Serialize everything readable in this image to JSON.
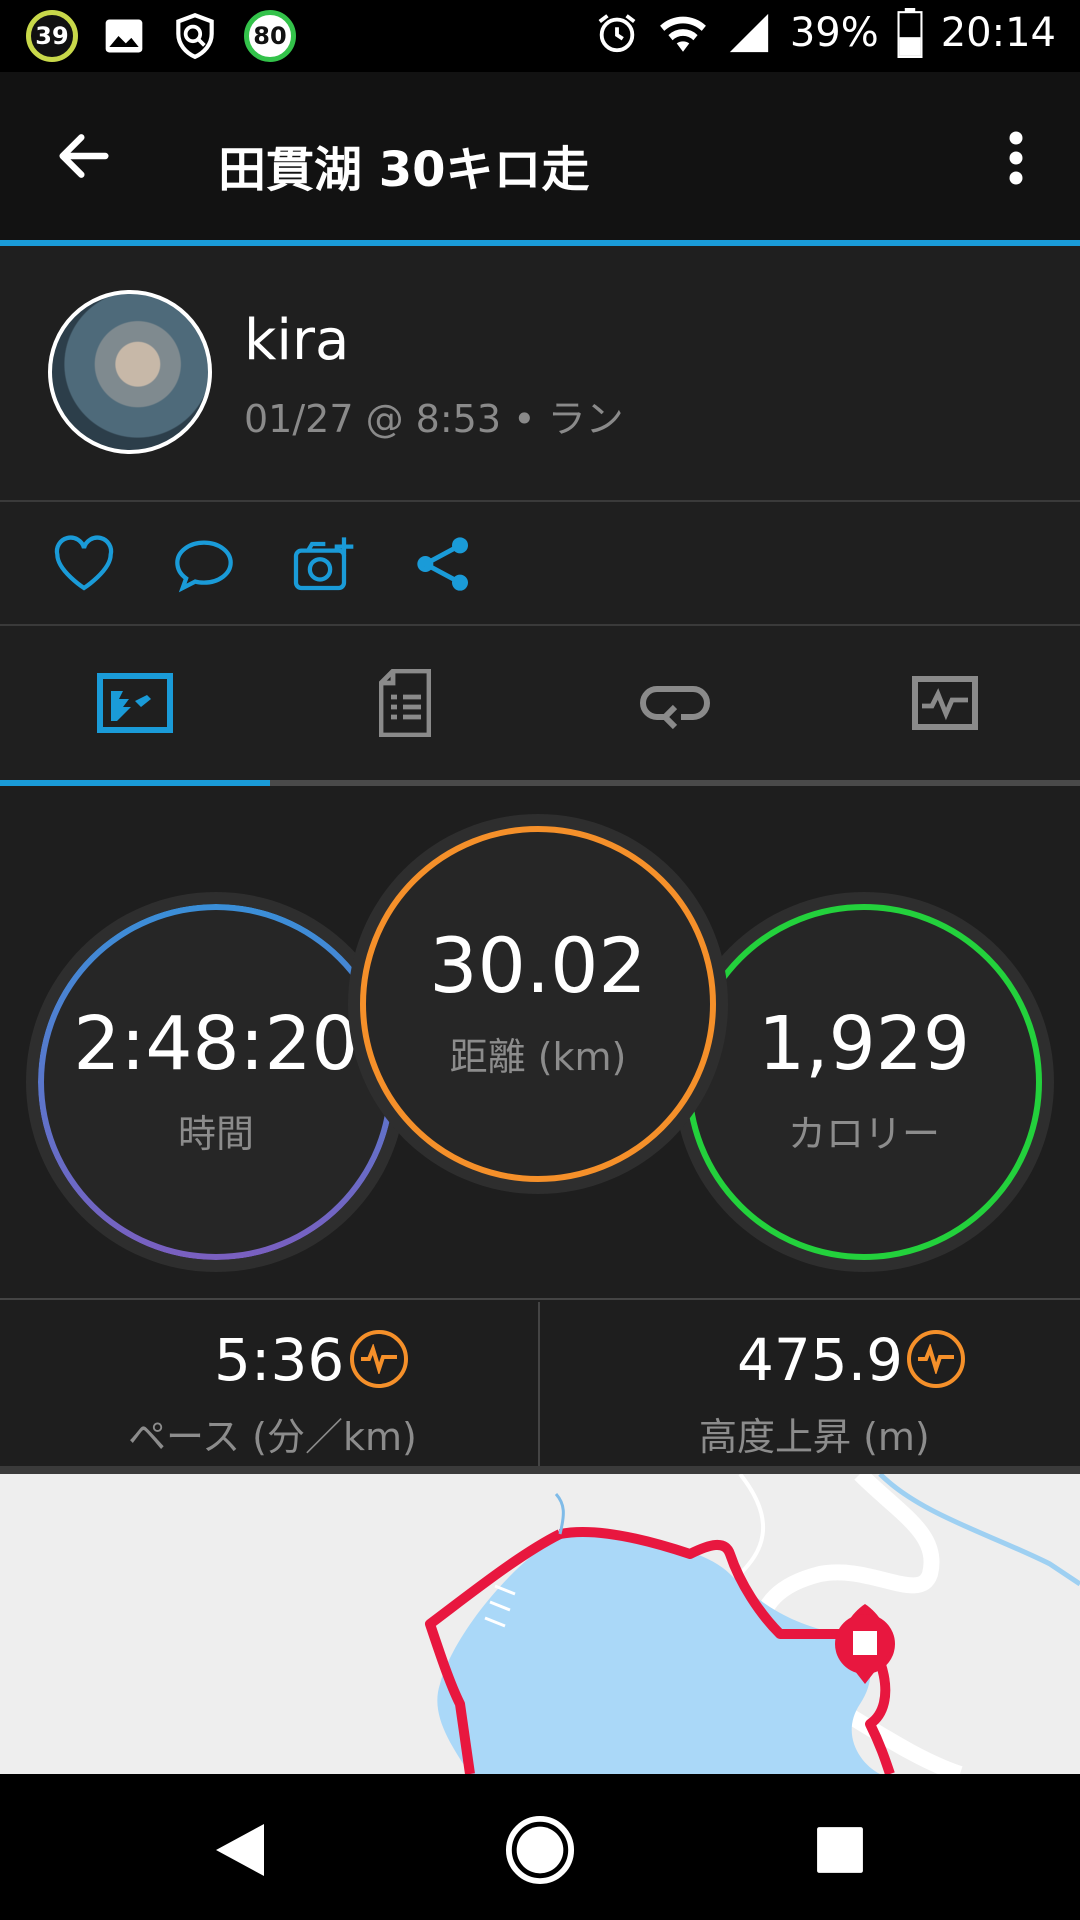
{
  "status_bar": {
    "badge_1": "39",
    "badge_2": "80",
    "battery": "39%",
    "time": "20:14"
  },
  "app_bar": {
    "title": "田貫湖 30キロ走"
  },
  "profile": {
    "name": "kira",
    "meta": "01/27 @ 8:53 • ラン"
  },
  "tabs": [
    "overview-icon",
    "details-icon",
    "laps-icon",
    "graphs-icon"
  ],
  "stats": {
    "time": {
      "value": "2:48:20",
      "label": "時間"
    },
    "distance": {
      "value": "30.02",
      "label": "距離 (km)"
    },
    "calories": {
      "value": "1,929",
      "label": "カロリー"
    }
  },
  "metrics": {
    "pace": {
      "value": "5:36",
      "label": "ペース (分／km)"
    },
    "elevation": {
      "value": "475.9",
      "label": "高度上昇 (m)"
    }
  },
  "colors": {
    "accent": "#1a9bd8",
    "distance_ring": "#f5902a",
    "calories_ring": "#23d13c",
    "route": "#e8173f",
    "water": "#aad8f8"
  }
}
